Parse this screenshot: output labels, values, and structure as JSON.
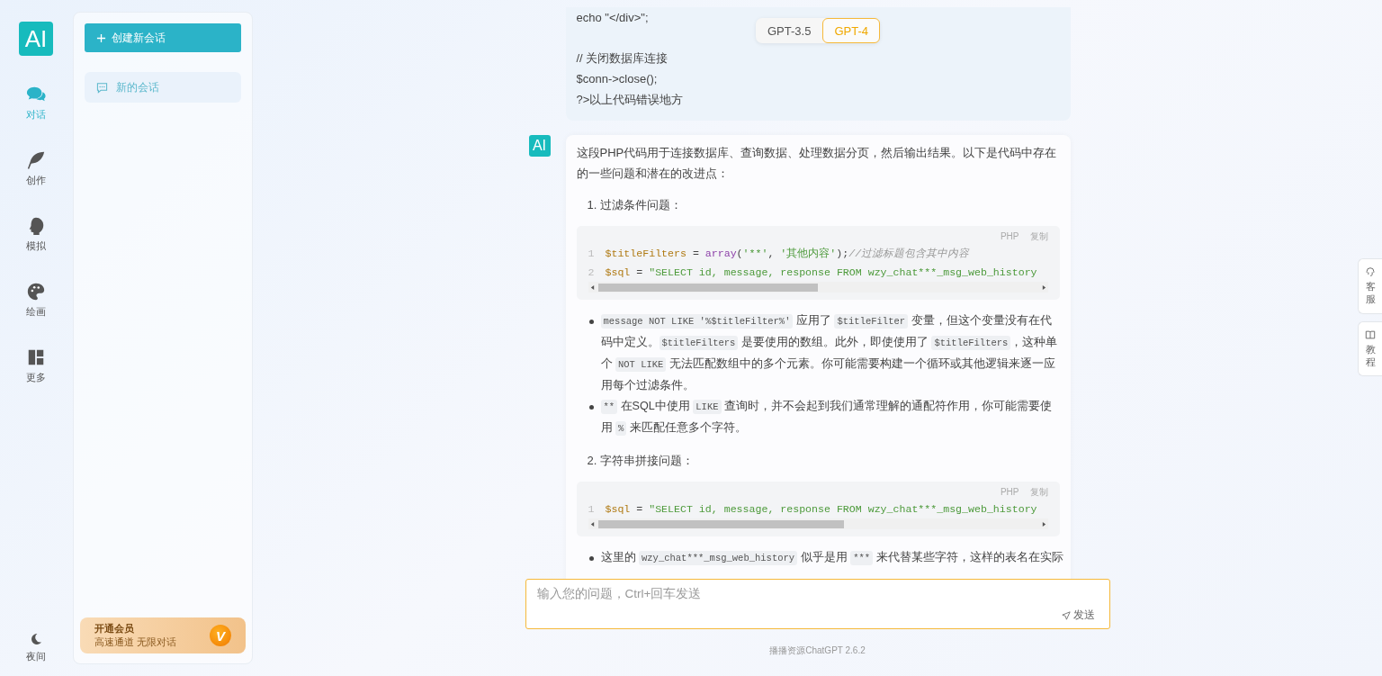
{
  "nav": {
    "logo": "AI",
    "items": [
      {
        "label": "对话",
        "selected": true
      },
      {
        "label": "创作",
        "selected": false
      },
      {
        "label": "模拟",
        "selected": false
      },
      {
        "label": "绘画",
        "selected": false
      },
      {
        "label": "更多",
        "selected": false
      }
    ],
    "night": {
      "label": "夜间"
    }
  },
  "sidebar": {
    "new_button": "创建新会话",
    "conversations": [
      {
        "title": "新的会话",
        "selected": true
      }
    ],
    "vip": {
      "title": "开通会员",
      "subtitle": "高速通道 无限对话",
      "badge": "V"
    }
  },
  "model_switch": [
    {
      "label": "GPT-3.5",
      "selected": false
    },
    {
      "label": "GPT-4",
      "selected": true
    }
  ],
  "messages": [
    {
      "kind": "user",
      "paragraphs": [
        [
          "echo \"</div>\";"
        ],
        [
          "// 关闭数据库连接",
          "$conn->close();",
          "?>以上代码错误地方"
        ]
      ]
    },
    {
      "kind": "assistant",
      "avatar": "AI",
      "blocks": [
        {
          "kind": "para",
          "text": "这段PHP代码用于连接数据库、查询数据、处理数据分页，然后输出结果。以下是代码中存在的一些问题和潜在的改进点："
        },
        {
          "kind": "heading",
          "number": "1.",
          "text": "过滤条件问题："
        },
        {
          "kind": "code",
          "lang": "PHP",
          "copy": "复制",
          "lines": [
            {
              "number": "1",
              "tokens": [
                {
                  "kind": "var",
                  "text": "$titleFilters"
                },
                {
                  "kind": "op",
                  "text": " = "
                },
                {
                  "kind": "fn",
                  "text": "array"
                },
                {
                  "kind": "op",
                  "text": "("
                },
                {
                  "kind": "str",
                  "text": "'**'"
                },
                {
                  "kind": "op",
                  "text": ", "
                },
                {
                  "kind": "str",
                  "text": "'其他内容'"
                },
                {
                  "kind": "op",
                  "text": ");"
                },
                {
                  "kind": "comment",
                  "text": "//过滤标题包含其中内容"
                }
              ]
            },
            {
              "number": "2",
              "tokens": [
                {
                  "kind": "var",
                  "text": "$sql"
                },
                {
                  "kind": "op",
                  "text": " = "
                },
                {
                  "kind": "str",
                  "text": "\"SELECT id, message, response FROM wzy_chat***_msg_web_history"
                }
              ]
            }
          ]
        },
        {
          "kind": "bullets",
          "items": [
            [
              {
                "kind": "code",
                "text": "message NOT LIKE '%$titleFilter%'"
              },
              {
                "kind": "text",
                "text": " 应用了 "
              },
              {
                "kind": "code",
                "text": "$titleFilter"
              },
              {
                "kind": "text",
                "text": " 变量，但这个变量没有在代码中定义。"
              },
              {
                "kind": "code",
                "text": "$titleFilters"
              },
              {
                "kind": "text",
                "text": " 是要使用的数组。此外，即使使用了 "
              },
              {
                "kind": "code",
                "text": "$titleFilters"
              },
              {
                "kind": "text",
                "text": "，这种单个 "
              },
              {
                "kind": "code",
                "text": "NOT LIKE"
              },
              {
                "kind": "text",
                "text": " 无法匹配数组中的多个元素。你可能需要构建一个循环或其他逻辑来逐一应用每个过滤条件。"
              }
            ],
            [
              {
                "kind": "code",
                "text": "**"
              },
              {
                "kind": "text",
                "text": " 在SQL中使用 "
              },
              {
                "kind": "code",
                "text": "LIKE"
              },
              {
                "kind": "text",
                "text": " 查询时，并不会起到我们通常理解的通配符作用，你可能需要使用 "
              },
              {
                "kind": "code",
                "text": "%"
              },
              {
                "kind": "text",
                "text": " 来匹配任意多个字符。"
              }
            ]
          ]
        },
        {
          "kind": "heading",
          "number": "2.",
          "text": "字符串拼接问题："
        },
        {
          "kind": "code",
          "lang": "PHP",
          "copy": "复制",
          "lines": [
            {
              "number": "1",
              "tokens": [
                {
                  "kind": "var",
                  "text": "$sql"
                },
                {
                  "kind": "op",
                  "text": " = "
                },
                {
                  "kind": "str",
                  "text": "\"SELECT id, message, response FROM wzy_chat***_msg_web_history"
                }
              ]
            }
          ]
        },
        {
          "kind": "bullets",
          "items": [
            [
              {
                "kind": "text",
                "text": "这里的 "
              },
              {
                "kind": "code",
                "text": "wzy_chat***_msg_web_history"
              },
              {
                "kind": "text",
                "text": " 似乎是用 "
              },
              {
                "kind": "code",
                "text": "***"
              },
              {
                "kind": "text",
                "text": " 来代替某些字符，这样的表名在实际"
              }
            ]
          ]
        }
      ]
    }
  ],
  "input": {
    "placeholder": "输入您的问题，Ctrl+回车发送",
    "send": "发送"
  },
  "footer": "播播资源ChatGPT 2.6.2",
  "float_buttons": [
    {
      "label": "客服"
    },
    {
      "label": "教程"
    }
  ]
}
